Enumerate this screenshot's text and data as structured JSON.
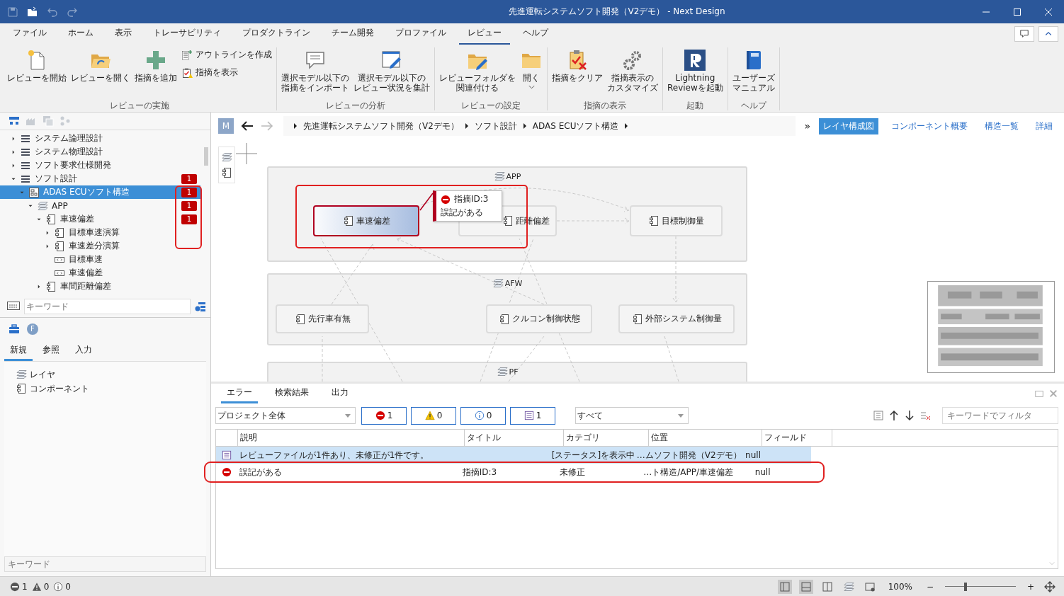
{
  "window": {
    "title": "先進運転システムソフト開発（V2デモ） - Next Design"
  },
  "menu_tabs": [
    {
      "label": "ファイル",
      "selected": false
    },
    {
      "label": "ホーム",
      "selected": false
    },
    {
      "label": "表示",
      "selected": false
    },
    {
      "label": "トレーサビリティ",
      "selected": false
    },
    {
      "label": "プロダクトライン",
      "selected": false
    },
    {
      "label": "チーム開発",
      "selected": false
    },
    {
      "label": "プロファイル",
      "selected": false
    },
    {
      "label": "レビュー",
      "selected": true
    },
    {
      "label": "ヘルプ",
      "selected": false
    }
  ],
  "ribbon": {
    "groups": [
      {
        "label": "レビューの実施",
        "buttons": [
          {
            "kind": "large",
            "lines": [
              "レビューを開始"
            ]
          },
          {
            "kind": "large",
            "lines": [
              "レビューを開く"
            ]
          },
          {
            "kind": "large",
            "lines": [
              "指摘を追加"
            ]
          },
          {
            "kind": "small",
            "lines": [
              "アウトラインを作成"
            ]
          },
          {
            "kind": "small",
            "lines": [
              "指摘を表示"
            ]
          }
        ]
      },
      {
        "label": "レビューの分析",
        "buttons": [
          {
            "kind": "large",
            "lines": [
              "選択モデル以下の",
              "指摘をインポート"
            ]
          },
          {
            "kind": "large",
            "lines": [
              "選択モデル以下の",
              "レビュー状況を集計"
            ]
          }
        ]
      },
      {
        "label": "レビューの設定",
        "buttons": [
          {
            "kind": "large",
            "lines": [
              "レビューフォルダを",
              "関連付ける"
            ]
          },
          {
            "kind": "dropdown",
            "lines": [
              "開く"
            ]
          }
        ]
      },
      {
        "label": "指摘の表示",
        "buttons": [
          {
            "kind": "large",
            "lines": [
              "指摘をクリア"
            ]
          },
          {
            "kind": "large",
            "lines": [
              "指摘表示の",
              "カスタマイズ"
            ]
          }
        ]
      },
      {
        "label": "起動",
        "buttons": [
          {
            "kind": "large",
            "lines": [
              "Lightning",
              "Reviewを起動"
            ]
          }
        ]
      },
      {
        "label": "ヘルプ",
        "buttons": [
          {
            "kind": "large",
            "lines": [
              "ユーザーズ",
              "マニュアル"
            ]
          }
        ]
      }
    ]
  },
  "tree": {
    "items": [
      {
        "kind": "list",
        "label": "システム論理設計",
        "expanded": false,
        "selected": false
      },
      {
        "kind": "list",
        "label": "システム物理設計",
        "expanded": false,
        "selected": false
      },
      {
        "kind": "list",
        "label": "ソフト要求仕様開発",
        "expanded": false,
        "selected": false
      },
      {
        "kind": "list",
        "label": "ソフト設計",
        "expanded": true,
        "selected": false,
        "badge": "1",
        "children": [
          {
            "kind": "model",
            "label": "ADAS ECUソフト構造",
            "expanded": true,
            "selected": true,
            "badge": "1",
            "children": [
              {
                "kind": "layer",
                "label": "APP",
                "expanded": true,
                "selected": false,
                "badge": "1",
                "children": [
                  {
                    "kind": "component",
                    "label": "車速偏差",
                    "expanded": true,
                    "selected": false,
                    "badge": "1",
                    "children": [
                      {
                        "kind": "component",
                        "label": "目標車速演算",
                        "expanded": false,
                        "selected": false
                      },
                      {
                        "kind": "component",
                        "label": "車速差分演算",
                        "expanded": false,
                        "selected": false
                      },
                      {
                        "kind": "port",
                        "label": "目標車速",
                        "selected": false
                      },
                      {
                        "kind": "port",
                        "label": "車速偏差",
                        "selected": false
                      }
                    ]
                  },
                  {
                    "kind": "component",
                    "label": "車間距離偏差",
                    "expanded": false,
                    "selected": false
                  }
                ]
              }
            ]
          }
        ]
      }
    ]
  },
  "tree_search": {
    "placeholder": "キーワード"
  },
  "toolbox": {
    "header_letter": "F",
    "tabs": [
      {
        "label": "新規",
        "selected": true
      },
      {
        "label": "参照",
        "selected": false
      },
      {
        "label": "入力",
        "selected": false
      }
    ],
    "items": [
      {
        "kind": "layer",
        "label": "レイヤ"
      },
      {
        "kind": "component",
        "label": "コンポーネント"
      }
    ],
    "search": {
      "placeholder": "キーワード"
    }
  },
  "breadcrumb": {
    "avatar": "M",
    "forward_disabled": true,
    "items": [
      "先進運転システムソフト開発（V2デモ）",
      "ソフト設計",
      "ADAS ECUソフト構造"
    ]
  },
  "view_tabs": {
    "more": "»",
    "tabs": [
      {
        "label": "レイヤ構成図",
        "selected": true
      },
      {
        "label": "コンポーネント概要",
        "selected": false
      },
      {
        "label": "構造一覧",
        "selected": false
      },
      {
        "label": "詳細",
        "selected": false
      }
    ]
  },
  "diagram": {
    "layers": [
      {
        "name": "APP",
        "nodes": [
          {
            "label": "車速偏差",
            "selected": true,
            "flagged": true
          },
          {
            "label": "距離偏差",
            "selected": false,
            "flagged": false
          },
          {
            "label": "目標制御量",
            "selected": false,
            "flagged": false
          }
        ]
      },
      {
        "name": "AFW",
        "nodes": [
          {
            "label": "先行車有無",
            "selected": false,
            "flagged": false
          },
          {
            "label": "クルコン制御状態",
            "selected": false,
            "flagged": false
          },
          {
            "label": "外部システム制御量",
            "selected": false,
            "flagged": false
          }
        ]
      },
      {
        "name": "PF"
      }
    ],
    "tooltip": {
      "title": "指摘ID:3",
      "text": "誤記がある"
    }
  },
  "output_panel": {
    "tabs": [
      {
        "label": "エラー",
        "selected": true
      },
      {
        "label": "検索結果",
        "selected": false
      },
      {
        "label": "出力",
        "selected": false
      }
    ],
    "scope": {
      "value": "プロジェクト全体"
    },
    "counters": [
      {
        "kind": "error",
        "count": "1"
      },
      {
        "kind": "warning",
        "count": "0"
      },
      {
        "kind": "info",
        "count": "0"
      },
      {
        "kind": "review",
        "count": "1"
      }
    ],
    "category": {
      "value": "すべて"
    },
    "filter": {
      "placeholder": "キーワードでフィルタ"
    },
    "table": {
      "columns": [
        "説明",
        "タイトル",
        "カテゴリ",
        "位置",
        "フィールド"
      ],
      "rows": [
        {
          "kind": "review",
          "selected": true,
          "cells": [
            "レビューファイルが1件あり、未修正が1件です。",
            null,
            "[ステータス]を表示中",
            "…ムソフト開発（V2デモ）",
            "null"
          ]
        },
        {
          "kind": "error",
          "selected": false,
          "flagged": true,
          "cells": [
            "誤記がある",
            "指摘ID:3",
            "未修正",
            "…ト構造/APP/車速偏差",
            "null"
          ]
        }
      ]
    }
  },
  "status_bar": {
    "counters": [
      {
        "kind": "error",
        "count": "1"
      },
      {
        "kind": "warning",
        "count": "0"
      },
      {
        "kind": "info",
        "count": "0"
      }
    ],
    "zoom": "100%",
    "minus": "−",
    "plus": "+",
    "zoom_slider": {
      "level": 0.27
    }
  }
}
